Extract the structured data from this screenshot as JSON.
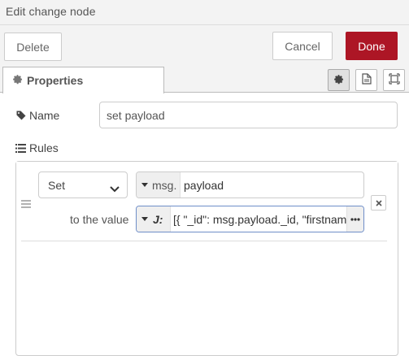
{
  "window": {
    "title": "Edit change node"
  },
  "toolbar": {
    "delete_label": "Delete",
    "cancel_label": "Cancel",
    "done_label": "Done"
  },
  "tabs": {
    "properties_label": "Properties"
  },
  "form": {
    "name_label": "Name",
    "name_value": "set payload",
    "rules_label": "Rules"
  },
  "rule": {
    "action": "Set",
    "target_type": "msg.",
    "target_value": "payload",
    "to_label": "to the value",
    "value_type_icon": "J:",
    "value": "[{ \"_id\": msg.payload._id, \"firstname\": msg.payload.firstname }]"
  },
  "colors": {
    "done_button": "#ad1625",
    "focus_border": "#6f8ec8"
  },
  "icons": {
    "tab": "gear-icon",
    "name": "tag-icon",
    "rules": "list-icon",
    "side": [
      "gear-icon",
      "document-icon",
      "frame-icon"
    ],
    "rule_handle": "drag-handle-icon",
    "expand": "ellipsis-icon",
    "remove": "close-icon"
  }
}
